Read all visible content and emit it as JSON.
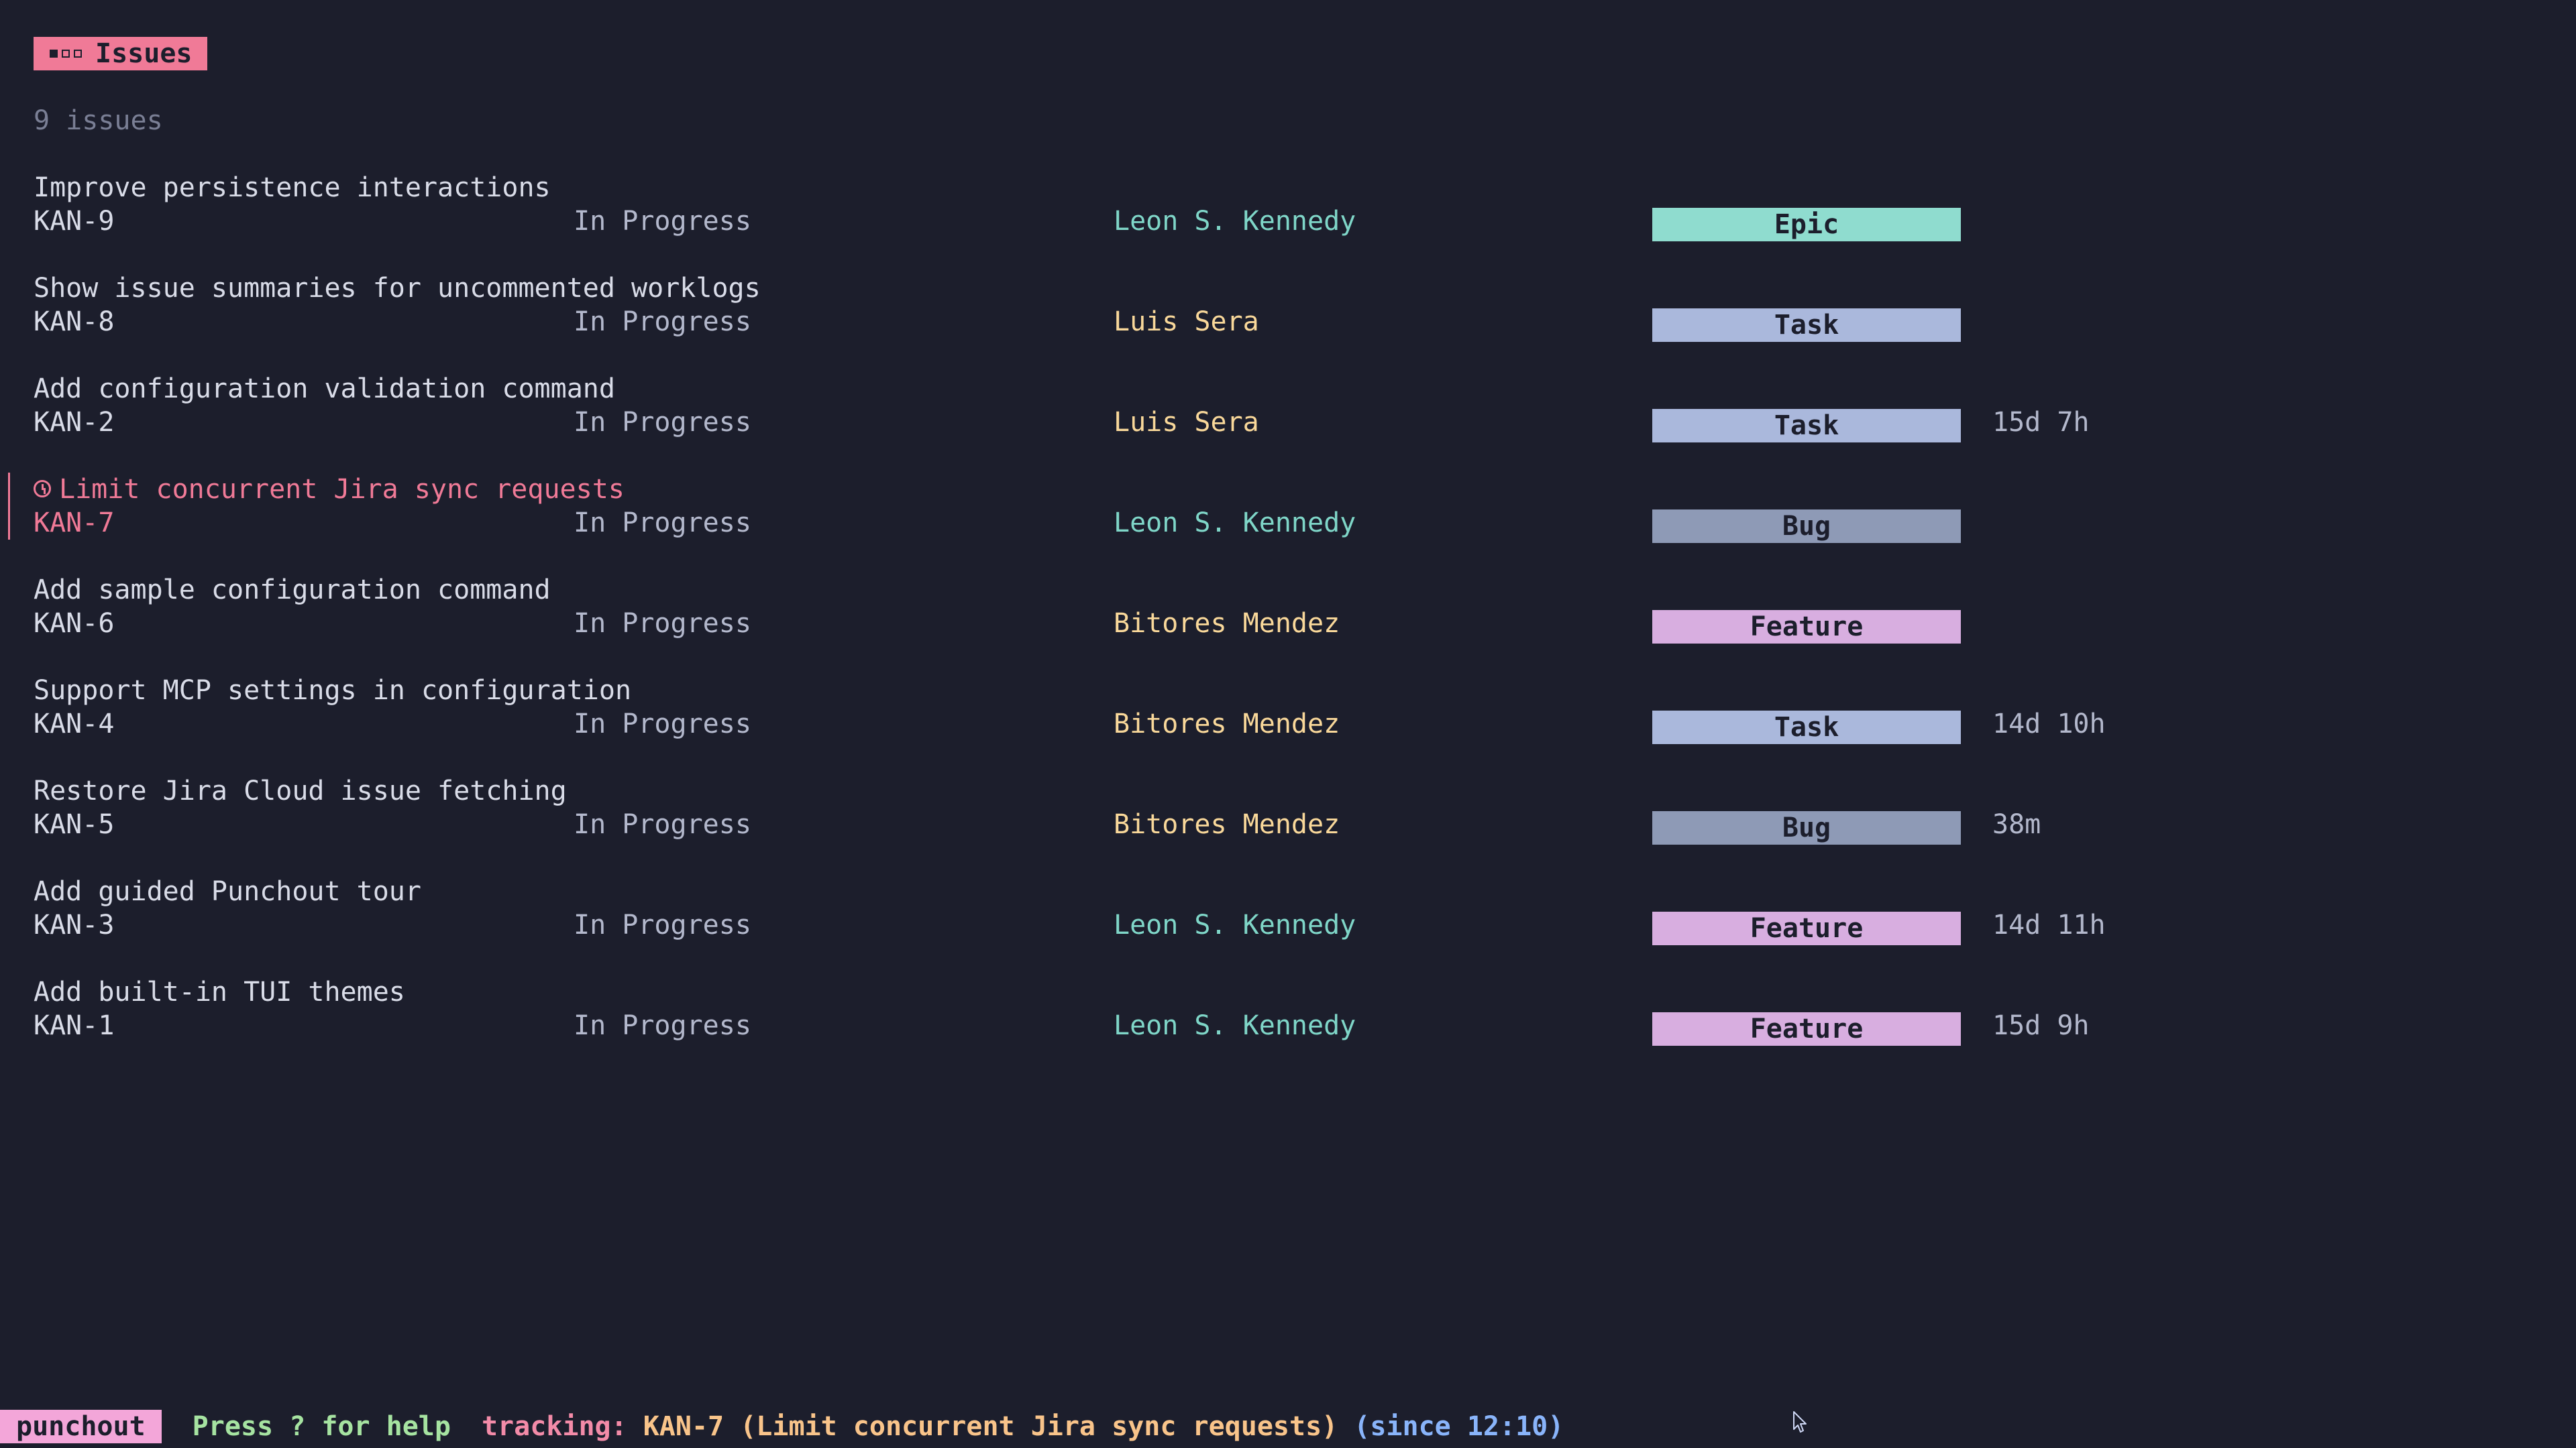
{
  "header": {
    "tab_label": "Issues",
    "tab_icon": "view-tabs-icon",
    "count_text": "9 issues",
    "accent_color": "#f07a97"
  },
  "issues": [
    {
      "title": "Improve persistence interactions",
      "key": "KAN-9",
      "status": "In Progress",
      "assignee": "Leon S. Kennedy",
      "assignee_color": "#7fd6c8",
      "type": "Epic",
      "type_color": "#8fdccf",
      "worklog": ""
    },
    {
      "title": "Show issue summaries for uncommented worklogs",
      "key": "KAN-8",
      "status": "In Progress",
      "assignee": "Luis Sera",
      "assignee_color": "#f9d89a",
      "type": "Task",
      "type_color": "#aab8dc",
      "worklog": ""
    },
    {
      "title": "Add configuration validation command",
      "key": "KAN-2",
      "status": "In Progress",
      "assignee": "Luis Sera",
      "assignee_color": "#f9d89a",
      "type": "Task",
      "type_color": "#aab8dc",
      "worklog": "15d 7h"
    },
    {
      "title": "Limit concurrent Jira sync requests",
      "key": "KAN-7",
      "status": "In Progress",
      "assignee": "Leon S. Kennedy",
      "assignee_color": "#7fd6c8",
      "type": "Bug",
      "type_color": "#8e9ab6",
      "worklog": "",
      "selected": true,
      "tracking": true
    },
    {
      "title": "Add sample configuration command",
      "key": "KAN-6",
      "status": "In Progress",
      "assignee": "Bitores Mendez",
      "assignee_color": "#f9d89a",
      "type": "Feature",
      "type_color": "#d8aee0",
      "worklog": ""
    },
    {
      "title": "Support MCP settings in configuration",
      "key": "KAN-4",
      "status": "In Progress",
      "assignee": "Bitores Mendez",
      "assignee_color": "#f9d89a",
      "type": "Task",
      "type_color": "#aab8dc",
      "worklog": "14d 10h"
    },
    {
      "title": "Restore Jira Cloud issue fetching",
      "key": "KAN-5",
      "status": "In Progress",
      "assignee": "Bitores Mendez",
      "assignee_color": "#f9d89a",
      "type": "Bug",
      "type_color": "#8e9ab6",
      "worklog": "38m"
    },
    {
      "title": "Add guided Punchout tour",
      "key": "KAN-3",
      "status": "In Progress",
      "assignee": "Leon S. Kennedy",
      "assignee_color": "#7fd6c8",
      "type": "Feature",
      "type_color": "#d8aee0",
      "worklog": "14d 11h"
    },
    {
      "title": "Add built-in TUI themes",
      "key": "KAN-1",
      "status": "In Progress",
      "assignee": "Leon S. Kennedy",
      "assignee_color": "#7fd6c8",
      "type": "Feature",
      "type_color": "#d8aee0",
      "worklog": "15d 9h"
    }
  ],
  "statusbar": {
    "app_name": "punchout",
    "help_text": "Press ? for help",
    "tracking_label": "tracking:",
    "tracking_value": "KAN-7 (Limit concurrent Jira sync requests)",
    "tracking_since": "(since 12:10)"
  },
  "cursor": {
    "icon": "mouse-pointer-icon"
  }
}
